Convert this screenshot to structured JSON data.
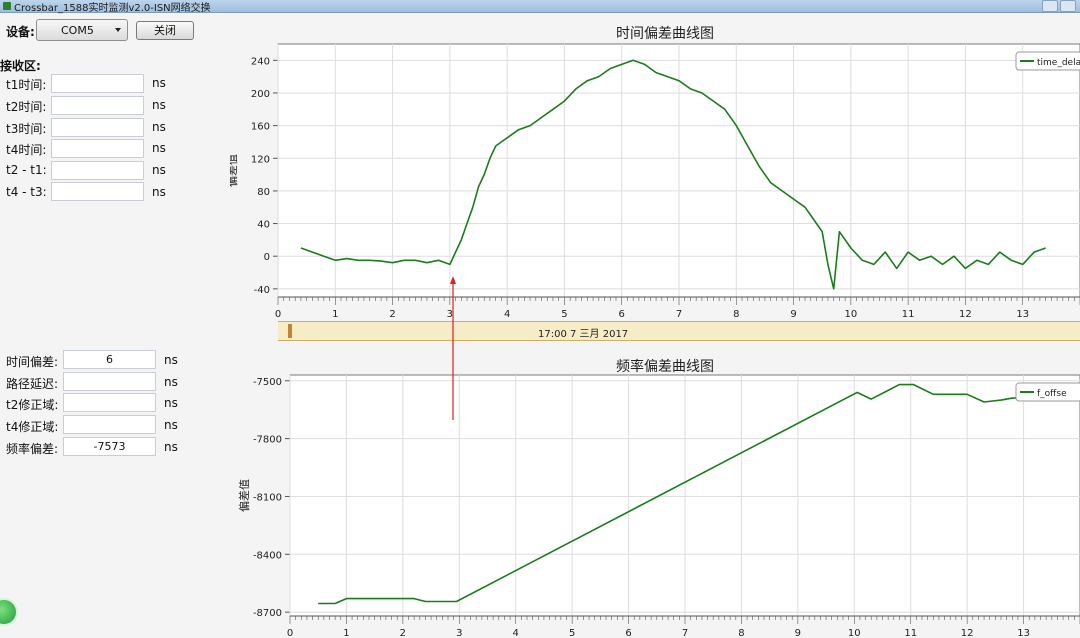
{
  "window": {
    "title": "Crossbar_1588实时监测v2.0-ISN网络交换"
  },
  "toolbar": {
    "device_label": "设备:",
    "device_value": "COM5",
    "close_button": "关闭"
  },
  "receive": {
    "section_title": "接收区:",
    "rows": [
      {
        "label": "t1时间:",
        "value": "",
        "unit": "ns"
      },
      {
        "label": "t2时间:",
        "value": "",
        "unit": "ns"
      },
      {
        "label": "t3时间:",
        "value": "",
        "unit": "ns"
      },
      {
        "label": "t4时间:",
        "value": "",
        "unit": "ns"
      },
      {
        "label": "t2 - t1:",
        "value": "",
        "unit": "ns"
      },
      {
        "label": "t4 - t3:",
        "value": "",
        "unit": "ns"
      }
    ]
  },
  "results": {
    "rows": [
      {
        "label": "时间偏差:",
        "value": "6",
        "unit": "ns"
      },
      {
        "label": "路径延迟:",
        "value": "",
        "unit": "ns"
      },
      {
        "label": "t2修正域:",
        "value": "",
        "unit": "ns"
      },
      {
        "label": "t4修正域:",
        "value": "",
        "unit": "ns"
      },
      {
        "label": "频率偏差:",
        "value": "-7573",
        "unit": "ns"
      }
    ]
  },
  "scrollbar": {
    "timestamp": "17:00 7 三月 2017"
  },
  "colors": {
    "series": "#1a7d1a",
    "annotation_arrow": "#e02020",
    "scroll_strip": "#f6ecc6"
  },
  "chart_data": [
    {
      "type": "line",
      "title": "时间偏差曲线图",
      "ylabel": "偏差值",
      "xlabel": "",
      "xlim": [
        0,
        14
      ],
      "ylim": [
        -50,
        260
      ],
      "yticks": [
        240,
        200,
        160,
        120,
        80,
        40,
        0,
        -40
      ],
      "xticks": [
        0,
        1,
        2,
        3,
        4,
        5,
        6,
        7,
        8,
        9,
        10,
        11,
        12,
        13
      ],
      "legend": "top-right",
      "grid": true,
      "series": [
        {
          "name": "time_dela",
          "x": [
            0.4,
            0.6,
            0.8,
            1.0,
            1.2,
            1.4,
            1.6,
            1.8,
            2.0,
            2.2,
            2.4,
            2.6,
            2.8,
            3.0,
            3.1,
            3.2,
            3.3,
            3.4,
            3.5,
            3.6,
            3.7,
            3.8,
            3.9,
            4.0,
            4.2,
            4.4,
            4.6,
            4.8,
            5.0,
            5.2,
            5.4,
            5.6,
            5.8,
            6.0,
            6.2,
            6.4,
            6.6,
            6.8,
            7.0,
            7.2,
            7.4,
            7.6,
            7.8,
            8.0,
            8.2,
            8.4,
            8.6,
            8.8,
            9.0,
            9.2,
            9.4,
            9.5,
            9.6,
            9.7,
            9.8,
            10.0,
            10.2,
            10.4,
            10.6,
            10.8,
            11.0,
            11.2,
            11.4,
            11.6,
            11.8,
            12.0,
            12.2,
            12.4,
            12.6,
            12.8,
            13.0,
            13.2,
            13.4
          ],
          "y": [
            10,
            5,
            0,
            -5,
            -3,
            -5,
            -5,
            -6,
            -8,
            -5,
            -5,
            -8,
            -5,
            -10,
            5,
            20,
            40,
            60,
            85,
            100,
            120,
            135,
            140,
            145,
            155,
            160,
            170,
            180,
            190,
            205,
            215,
            220,
            230,
            235,
            240,
            235,
            225,
            220,
            215,
            205,
            200,
            190,
            180,
            160,
            135,
            110,
            90,
            80,
            70,
            60,
            40,
            30,
            -10,
            -40,
            30,
            10,
            -5,
            -10,
            5,
            -15,
            5,
            -5,
            0,
            -10,
            0,
            -15,
            -5,
            -10,
            5,
            -5,
            -10,
            5,
            10
          ]
        }
      ]
    },
    {
      "type": "line",
      "title": "频率偏差曲线图",
      "ylabel": "偏差值",
      "xlabel": "",
      "xlim": [
        0,
        14
      ],
      "ylim": [
        -8720,
        -7470
      ],
      "yticks": [
        -7500,
        -7800,
        -8100,
        -8400,
        -8700
      ],
      "xticks": [
        0,
        1,
        2,
        3,
        4,
        5,
        6,
        7,
        8,
        9,
        10,
        11,
        12,
        13
      ],
      "legend": "top-right",
      "grid": true,
      "series": [
        {
          "name": "f_offse",
          "x": [
            0.5,
            0.8,
            1.0,
            1.2,
            1.6,
            2.0,
            2.2,
            2.4,
            2.8,
            2.95,
            10.05,
            10.3,
            10.8,
            11.05,
            11.4,
            12.0,
            12.3,
            12.6,
            12.8,
            13.3
          ],
          "y": [
            -8655,
            -8655,
            -8630,
            -8630,
            -8630,
            -8630,
            -8630,
            -8645,
            -8645,
            -8645,
            -7560,
            -7595,
            -7520,
            -7520,
            -7570,
            -7570,
            -7610,
            -7600,
            -7590,
            -7590
          ]
        }
      ]
    }
  ]
}
